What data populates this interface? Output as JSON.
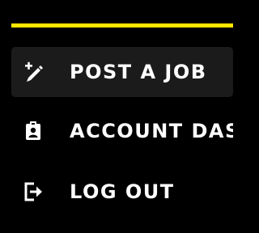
{
  "colors": {
    "background": "#000000",
    "accent": "#ffe500",
    "active_item_background": "#1b1b1b",
    "text": "#ffffff"
  },
  "menu": {
    "items": [
      {
        "label": "POST A JOB",
        "icon": "edit-plus-icon",
        "active": true
      },
      {
        "label": "ACCOUNT DAS",
        "icon": "id-badge-icon",
        "active": false
      },
      {
        "label": "LOG OUT",
        "icon": "logout-icon",
        "active": false
      }
    ]
  }
}
